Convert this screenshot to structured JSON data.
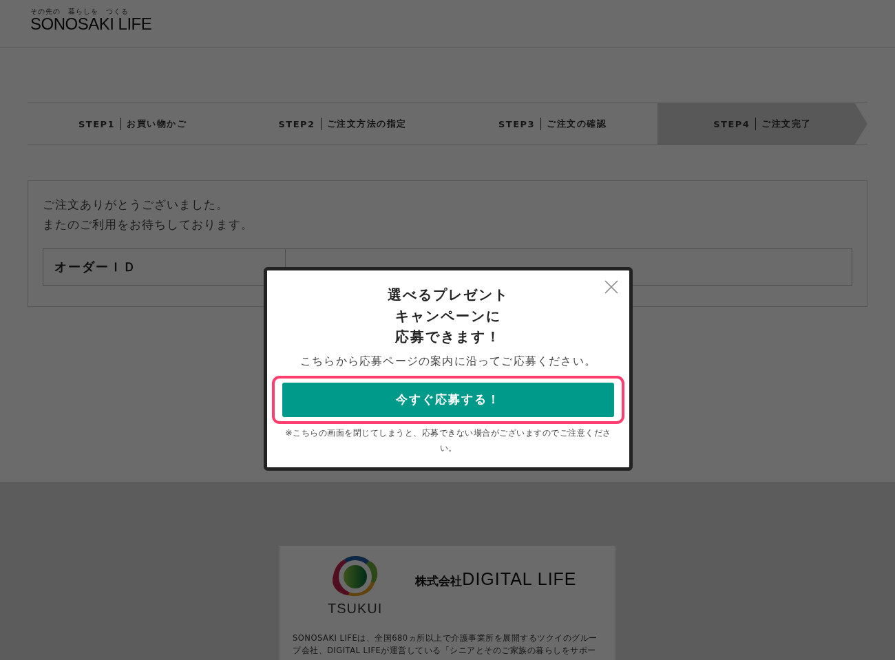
{
  "header": {
    "tagline": "その先の　暮らしを　つくる",
    "logo": "SONOSAKI LIFE"
  },
  "steps": [
    {
      "number": "STEP1",
      "label": "お買い物かご",
      "selected": false
    },
    {
      "number": "STEP2",
      "label": "ご注文方法の指定",
      "selected": false
    },
    {
      "number": "STEP3",
      "label": "ご注文の確認",
      "selected": false
    },
    {
      "number": "STEP4",
      "label": "ご注文完了",
      "selected": true
    }
  ],
  "thanks": {
    "lines": [
      "ご注文ありがとうございました。",
      "またのご利用をお待ちしております。"
    ],
    "order_id_label": "オーダーＩＤ"
  },
  "footer": {
    "brand": "TSUKUI",
    "company_prefix": "株式会社",
    "company": "DIGITAL LIFE",
    "description": "SONOSAKI LIFEは、全国680ヵ所以上で介護事業所を展開するツクイのグループ会社、DIGITAL LIFEが運営している「シニアとそのご家族の暮らしをサポー"
  },
  "modal": {
    "title_lines": [
      "選べるプレゼント",
      "キャンペーンに",
      "応募できます！"
    ],
    "message": "こちらから応募ページの案内に沿ってご応募ください。",
    "button": "今すぐ応募する！",
    "note": "※こちらの画面を閉じてしまうと、応募できない場合がございますのでご注意ください。"
  }
}
